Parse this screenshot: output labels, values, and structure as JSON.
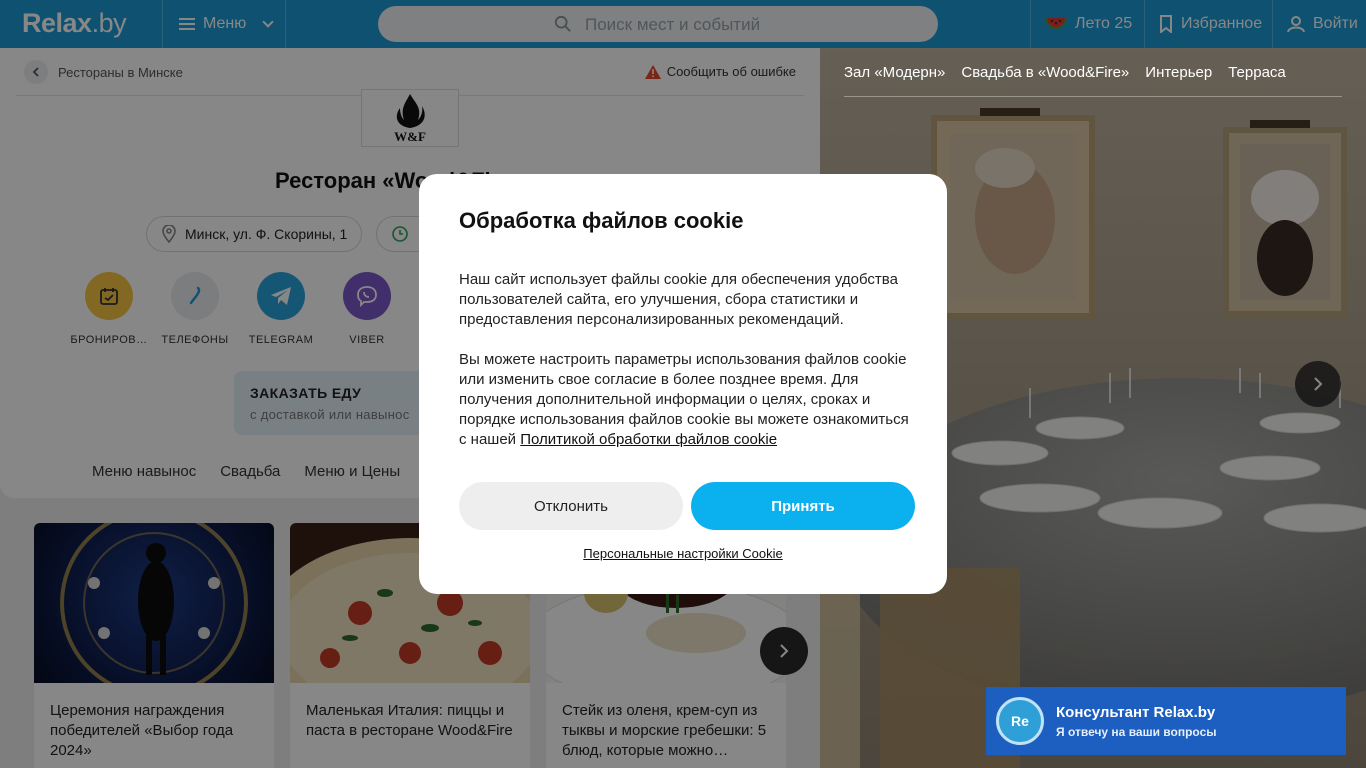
{
  "header": {
    "logo_main": "Relax",
    "logo_suffix": ".by",
    "menu_label": "Меню",
    "search_placeholder": "Поиск мест и событий",
    "summer_label": "Лето 25",
    "favorites_label": "Избранное",
    "login_label": "Войти"
  },
  "breadcrumb": {
    "label": "Рестораны в Минске"
  },
  "report_label": "Сообщить об ошибке",
  "venue": {
    "logo_text": "W&F",
    "title": "Ресторан «Wood&Fire»",
    "address": "Минск, ул. Ф. Скорины, 1"
  },
  "actions": [
    {
      "label": "БРОНИРОВ…",
      "icon": "calendar-icon",
      "color": "#f5c542"
    },
    {
      "label": "ТЕЛЕФОНЫ",
      "icon": "phone-icon",
      "color": "#e9edf0"
    },
    {
      "label": "TELEGRAM",
      "icon": "telegram-icon",
      "color": "#2aa3dd"
    },
    {
      "label": "VIBER",
      "icon": "viber-icon",
      "color": "#7a59c9"
    }
  ],
  "order": {
    "title": "ЗАКАЗАТЬ ЕДУ",
    "subtitle": "с доставкой или навынос"
  },
  "tabs": [
    "Меню навынос",
    "Свадьба",
    "Меню и Цены"
  ],
  "news": [
    {
      "text": "Церемония награждения победителей «Выбор года 2024»"
    },
    {
      "text": "Маленькая Италия: пиццы и паста в ресторане Wood&Fire"
    },
    {
      "text": "Стейк из оленя, крем-суп из тыквы и морские гребешки: 5 блюд, которые можно…"
    }
  ],
  "gallery": {
    "tabs": [
      "Зал «Модерн»",
      "Свадьба в «Wood&Fire»",
      "Интерьер",
      "Терраса"
    ]
  },
  "cookie_modal": {
    "title": "Обработка файлов cookie",
    "paragraph1": "Наш сайт использует файлы cookie для обеспечения удобства пользователей сайта, его улучшения, сбора статистики и предоставления персонализированных рекомендаций.",
    "paragraph2": "Вы можете настроить параметры использования файлов cookie или изменить свое согласие в более позднее время. Для получения дополнительной информации о целях, сроках и порядке использования файлов cookie вы можете ознакомиться с нашей",
    "policy_link": "Политикой обработки файлов cookie",
    "decline_label": "Отклонить",
    "accept_label": "Принять",
    "settings_link": "Персональные настройки Cookie"
  },
  "consultant": {
    "avatar_text": "Re",
    "name": "Консультант Relax.by",
    "subtitle": "Я отвечу на ваши вопросы"
  },
  "colors": {
    "header_bg": "#1c9ad6",
    "accept_bg": "#0bb0ef",
    "consultant_bg": "#1c5fc0"
  }
}
